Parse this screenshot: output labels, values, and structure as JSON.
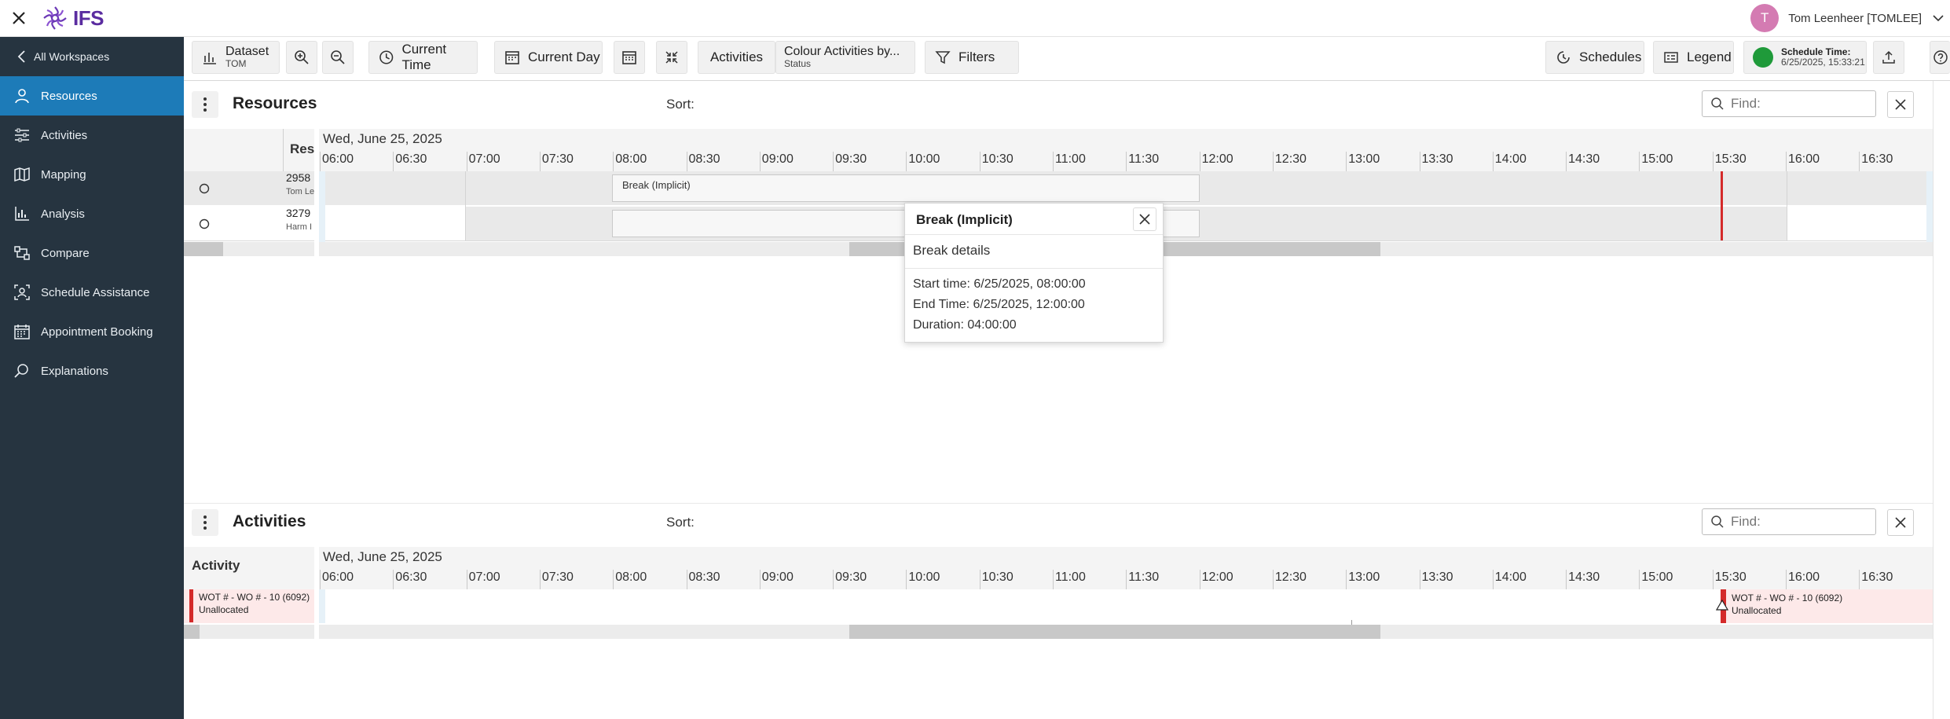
{
  "app": {
    "logo_text": "IFS"
  },
  "user": {
    "initial": "T",
    "name": "Tom Leenheer [TOMLEE]"
  },
  "sidebar": {
    "back_label": "All Workspaces",
    "items": [
      {
        "label": "Resources",
        "icon": "person-icon",
        "active": true
      },
      {
        "label": "Activities",
        "icon": "sliders-icon"
      },
      {
        "label": "Mapping",
        "icon": "map-icon"
      },
      {
        "label": "Analysis",
        "icon": "chart-icon"
      },
      {
        "label": "Compare",
        "icon": "compare-icon"
      },
      {
        "label": "Schedule Assistance",
        "icon": "schedule-assist-icon"
      },
      {
        "label": "Appointment Booking",
        "icon": "calendar-icon"
      },
      {
        "label": "Explanations",
        "icon": "search-icon"
      }
    ]
  },
  "toolbar": {
    "dataset_label": "Dataset",
    "dataset_value": "TOM",
    "current_time": "Current Time",
    "current_day": "Current Day",
    "activities": "Activities",
    "colour_label": "Colour Activities by...",
    "colour_value": "Status",
    "filters": "Filters",
    "schedules": "Schedules",
    "legend": "Legend",
    "schedule_time_label": "Schedule Time:",
    "schedule_time_value": "6/25/2025, 15:33:21",
    "status_color": "#1f9a3a"
  },
  "resources_panel": {
    "title": "Resources",
    "sort_label": "Sort:",
    "find_placeholder": "Find:",
    "column_header": "Reso",
    "date": "Wed, June 25, 2025",
    "ticks": [
      "06:00",
      "06:30",
      "07:00",
      "07:30",
      "08:00",
      "08:30",
      "09:00",
      "09:30",
      "10:00",
      "10:30",
      "11:00",
      "11:30",
      "12:00",
      "12:30",
      "13:00",
      "13:30",
      "14:00",
      "14:30",
      "15:00",
      "15:30",
      "16:00",
      "16:30"
    ],
    "rows": [
      {
        "id": "2958",
        "name": "Tom Le"
      },
      {
        "id": "3279",
        "name": "Harm I"
      }
    ],
    "break_label": "Break (Implicit)"
  },
  "popup": {
    "title": "Break (Implicit)",
    "subtitle": "Break details",
    "start": "Start time: 6/25/2025, 08:00:00",
    "end": "End Time: 6/25/2025, 12:00:00",
    "duration": "Duration: 04:00:00"
  },
  "activities_panel": {
    "title": "Activities",
    "sort_label": "Sort:",
    "find_placeholder": "Find:",
    "column_header": "Activity",
    "date": "Wed, June 25, 2025",
    "rows": [
      {
        "line1": "WOT # - WO # - 10 (6092)",
        "line2": "Unallocated"
      }
    ],
    "timeline_label_1": "WOT # - WO # - 10 (6092)",
    "timeline_label_2": "Unallocated",
    "marker_color": "#d42a2a"
  }
}
